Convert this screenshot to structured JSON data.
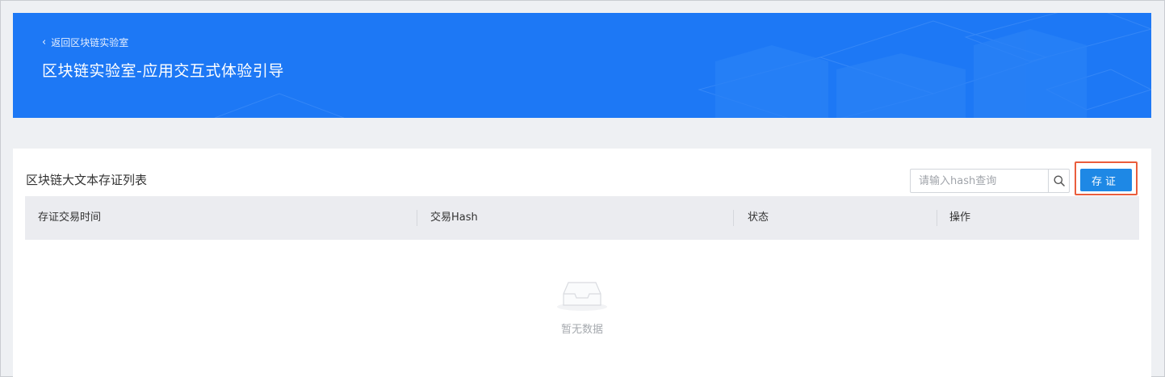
{
  "header": {
    "back_label": "返回区块链实验室",
    "title": "区块链实验室-应用交互式体验引导"
  },
  "list": {
    "title": "区块链大文本存证列表",
    "search_placeholder": "请输入hash查询",
    "submit_label": "存证",
    "columns": [
      "存证交易时间",
      "交易Hash",
      "状态",
      "操作"
    ],
    "empty_text": "暂无数据"
  },
  "icons": {
    "back": "chevron-left-icon",
    "search": "search-icon",
    "empty": "empty-inbox-icon"
  },
  "colors": {
    "banner": "#1d78f5",
    "primary_button": "#1e88e5",
    "highlight_border": "#ea5d3c"
  }
}
